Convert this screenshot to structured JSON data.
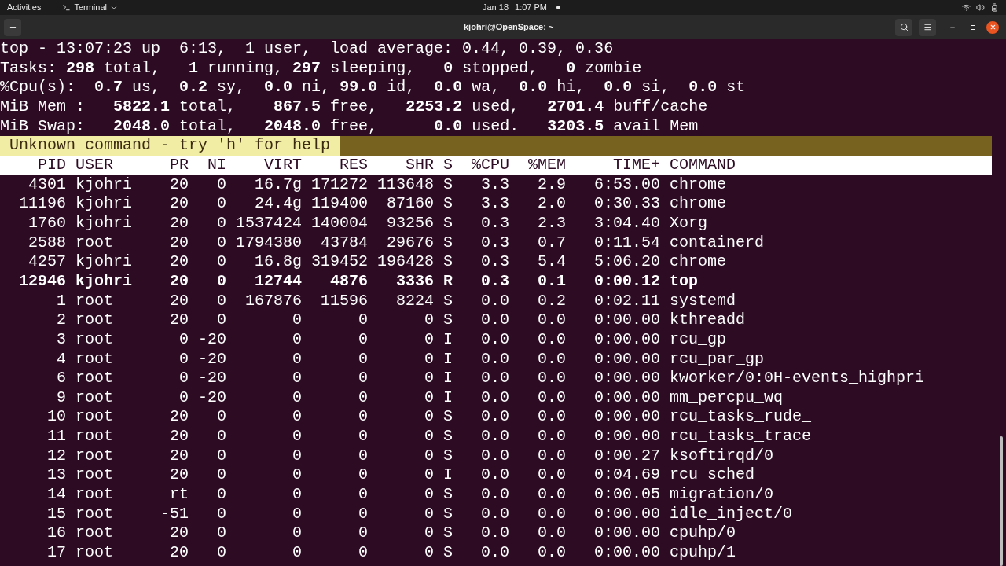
{
  "top_bar": {
    "activities": "Activities",
    "app_menu": "Terminal",
    "date": "Jan 18",
    "time": "1:07 PM"
  },
  "window": {
    "title": "kjohri@OpenSpace: ~"
  },
  "summary_lines": [
    "top - 13:07:23 up  6:13,  1 user,  load average: 0.44, 0.39, 0.36",
    "Tasks: **298** total,   **1** running, **297** sleeping,   **0** stopped,   **0** zombie",
    "%Cpu(s):  **0.7** us,  **0.2** sy,  **0.0** ni, **99.0** id,  **0.0** wa,  **0.0** hi,  **0.0** si,  **0.0** st",
    "MiB Mem :   **5822.1** total,    **867.5** free,   **2253.2** used,   **2701.4** buff/cache",
    "MiB Swap:   **2048.0** total,   **2048.0** free,      **0.0** used.   **3203.5** avail Mem"
  ],
  "message": "Unknown command - try 'h' for help",
  "table": {
    "columns": [
      "PID",
      "USER",
      "PR",
      "NI",
      "VIRT",
      "RES",
      "SHR",
      "S",
      "%CPU",
      "%MEM",
      "TIME+",
      "COMMAND"
    ],
    "rows": [
      {
        "bold": false,
        "cells": [
          "4301",
          "kjohri",
          "20",
          "0",
          "16.7g",
          "171272",
          "113648",
          "S",
          "3.3",
          "2.9",
          "6:53.00",
          "chrome"
        ]
      },
      {
        "bold": false,
        "cells": [
          "11196",
          "kjohri",
          "20",
          "0",
          "24.4g",
          "119400",
          "87160",
          "S",
          "3.3",
          "2.0",
          "0:30.33",
          "chrome"
        ]
      },
      {
        "bold": false,
        "cells": [
          "1760",
          "kjohri",
          "20",
          "0",
          "1537424",
          "140004",
          "93256",
          "S",
          "0.3",
          "2.3",
          "3:04.40",
          "Xorg"
        ]
      },
      {
        "bold": false,
        "cells": [
          "2588",
          "root",
          "20",
          "0",
          "1794380",
          "43784",
          "29676",
          "S",
          "0.3",
          "0.7",
          "0:11.54",
          "containerd"
        ]
      },
      {
        "bold": false,
        "cells": [
          "4257",
          "kjohri",
          "20",
          "0",
          "16.8g",
          "319452",
          "196428",
          "S",
          "0.3",
          "5.4",
          "5:06.20",
          "chrome"
        ]
      },
      {
        "bold": true,
        "cells": [
          "12946",
          "kjohri",
          "20",
          "0",
          "12744",
          "4876",
          "3336",
          "R",
          "0.3",
          "0.1",
          "0:00.12",
          "top"
        ]
      },
      {
        "bold": false,
        "cells": [
          "1",
          "root",
          "20",
          "0",
          "167876",
          "11596",
          "8224",
          "S",
          "0.0",
          "0.2",
          "0:02.11",
          "systemd"
        ]
      },
      {
        "bold": false,
        "cells": [
          "2",
          "root",
          "20",
          "0",
          "0",
          "0",
          "0",
          "S",
          "0.0",
          "0.0",
          "0:00.00",
          "kthreadd"
        ]
      },
      {
        "bold": false,
        "cells": [
          "3",
          "root",
          "0",
          "-20",
          "0",
          "0",
          "0",
          "I",
          "0.0",
          "0.0",
          "0:00.00",
          "rcu_gp"
        ]
      },
      {
        "bold": false,
        "cells": [
          "4",
          "root",
          "0",
          "-20",
          "0",
          "0",
          "0",
          "I",
          "0.0",
          "0.0",
          "0:00.00",
          "rcu_par_gp"
        ]
      },
      {
        "bold": false,
        "cells": [
          "6",
          "root",
          "0",
          "-20",
          "0",
          "0",
          "0",
          "I",
          "0.0",
          "0.0",
          "0:00.00",
          "kworker/0:0H-events_highpri"
        ]
      },
      {
        "bold": false,
        "cells": [
          "9",
          "root",
          "0",
          "-20",
          "0",
          "0",
          "0",
          "I",
          "0.0",
          "0.0",
          "0:00.00",
          "mm_percpu_wq"
        ]
      },
      {
        "bold": false,
        "cells": [
          "10",
          "root",
          "20",
          "0",
          "0",
          "0",
          "0",
          "S",
          "0.0",
          "0.0",
          "0:00.00",
          "rcu_tasks_rude_"
        ]
      },
      {
        "bold": false,
        "cells": [
          "11",
          "root",
          "20",
          "0",
          "0",
          "0",
          "0",
          "S",
          "0.0",
          "0.0",
          "0:00.00",
          "rcu_tasks_trace"
        ]
      },
      {
        "bold": false,
        "cells": [
          "12",
          "root",
          "20",
          "0",
          "0",
          "0",
          "0",
          "S",
          "0.0",
          "0.0",
          "0:00.27",
          "ksoftirqd/0"
        ]
      },
      {
        "bold": false,
        "cells": [
          "13",
          "root",
          "20",
          "0",
          "0",
          "0",
          "0",
          "I",
          "0.0",
          "0.0",
          "0:04.69",
          "rcu_sched"
        ]
      },
      {
        "bold": false,
        "cells": [
          "14",
          "root",
          "rt",
          "0",
          "0",
          "0",
          "0",
          "S",
          "0.0",
          "0.0",
          "0:00.05",
          "migration/0"
        ]
      },
      {
        "bold": false,
        "cells": [
          "15",
          "root",
          "-51",
          "0",
          "0",
          "0",
          "0",
          "S",
          "0.0",
          "0.0",
          "0:00.00",
          "idle_inject/0"
        ]
      },
      {
        "bold": false,
        "cells": [
          "16",
          "root",
          "20",
          "0",
          "0",
          "0",
          "0",
          "S",
          "0.0",
          "0.0",
          "0:00.00",
          "cpuhp/0"
        ]
      },
      {
        "bold": false,
        "cells": [
          "17",
          "root",
          "20",
          "0",
          "0",
          "0",
          "0",
          "S",
          "0.0",
          "0.0",
          "0:00.00",
          "cpuhp/1"
        ]
      }
    ]
  }
}
